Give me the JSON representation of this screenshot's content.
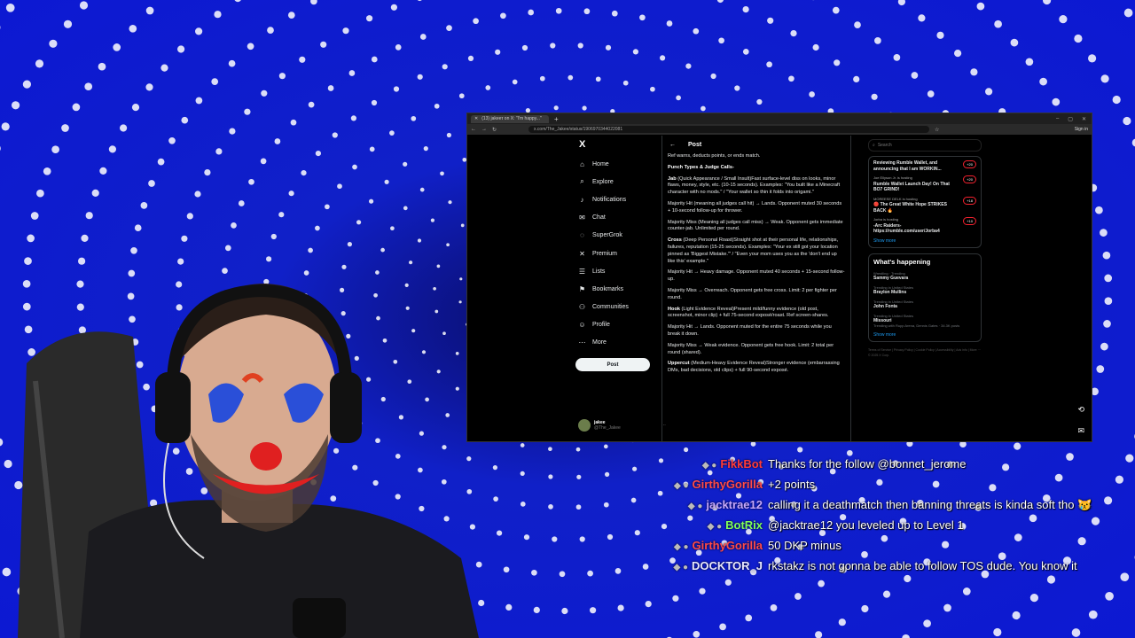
{
  "browser": {
    "tab_title": "(13) jakeeτ on X: \"I'm happy...\"",
    "url": "x.com/The_Jakee/status/1906970344022081",
    "sign_in": "Sign in"
  },
  "x": {
    "logo": "X",
    "nav": [
      {
        "label": "Home",
        "icon": "home-icon",
        "glyph": "⌂"
      },
      {
        "label": "Explore",
        "icon": "search-icon",
        "glyph": "⌕"
      },
      {
        "label": "Notifications",
        "icon": "bell-icon",
        "glyph": "♪"
      },
      {
        "label": "Chat",
        "icon": "mail-icon",
        "glyph": "✉"
      },
      {
        "label": "SuperGrok",
        "icon": "grok-icon",
        "glyph": "◌"
      },
      {
        "label": "Premium",
        "icon": "x-icon",
        "glyph": "✕"
      },
      {
        "label": "Lists",
        "icon": "list-icon",
        "glyph": "☰"
      },
      {
        "label": "Bookmarks",
        "icon": "bookmark-icon",
        "glyph": "⚑"
      },
      {
        "label": "Communities",
        "icon": "people-icon",
        "glyph": "⚇"
      },
      {
        "label": "Profile",
        "icon": "profile-icon",
        "glyph": "☺"
      },
      {
        "label": "More",
        "icon": "more-icon",
        "glyph": "⋯"
      }
    ],
    "post_button": "Post",
    "account": {
      "name": "jakee",
      "handle": "@The_Jakee"
    },
    "post_header": "Post",
    "thread": [
      {
        "bold": "",
        "text": "Ref warns, deducts points, or ends match."
      },
      {
        "bold": "Punch Types & Judge Calls-",
        "text": ""
      },
      {
        "bold": "Jab",
        "text": " (Quick Appearance / Small Insult)Fast surface-level diss on looks, minor flaws, money, style, etc. (10-15 seconds). Examples: \"You built like a Minecraft character with no mods.\" / \"Your wallet so thin it folds into origami.\""
      },
      {
        "bold": "",
        "text": "Majority Hit (meaning all judges call hit) → Lands. Opponent muted 30 seconds + 10-second follow-up for thrower."
      },
      {
        "bold": "",
        "text": "Majority Miss (Meaning all judges call miss) → Weak. Opponent gets immediate counter-jab. Unlimited per round."
      },
      {
        "bold": "Cross",
        "text": " (Deep Personal Roast)Straight shot at their personal life, relationships, failures, reputation (15-25 seconds). Examples: \"Your ex still got your location pinned as 'Biggest Mistake.'\" / \"Even your mom uses you as the 'don't end up like this' example.\""
      },
      {
        "bold": "",
        "text": "Majority Hit → Heavy damage. Opponent muted 40 seconds + 15-second follow-up."
      },
      {
        "bold": "",
        "text": "Majority Miss → Overreach. Opponent gets free cross. Limit: 2 per fighter per round."
      },
      {
        "bold": "Hook",
        "text": " (Light Evidence Reveal)Present mild/funny evidence (old post, screenshot, minor clip) + full 75-second exposé/roast. Ref screen-shares."
      },
      {
        "bold": "",
        "text": "Majority Hit → Lands. Opponent muted for the entire 75 seconds while you break it down."
      },
      {
        "bold": "",
        "text": "Majority Miss → Weak evidence. Opponent gets free hook. Limit: 2 total per round (shared)."
      },
      {
        "bold": "Uppercut",
        "text": " (Medium-Heavy Evidence Reveal)Stronger evidence (embarrassing DMs, bad decisions, old clips) + full 90-second exposé."
      }
    ],
    "search_placeholder": "Search",
    "live": [
      {
        "title": "Reviewing Rumble Wallet, and announcing that I am WORKIN...",
        "host": "",
        "count": "+20"
      },
      {
        "title": "Rumble Wallet Launch Day! On That BO7 GRIND!",
        "host": "Joe Ellyson Jr. is hosting",
        "count": "+20"
      },
      {
        "title": "🔴 The Great White Hope STRIKES BACK 🔥",
        "host": "MOREESE DELK is hosting",
        "count": "+18"
      },
      {
        "title": "-Arc Raiders- https://rumble.com/user/Jorba4",
        "host": "Jorba is hosting",
        "count": "+10"
      }
    ],
    "live_show_more": "Show more",
    "whats_happening": "What's happening",
    "trends": [
      {
        "ctx": "Wrestling · Trending",
        "name": "Sammy Guevara",
        "sub": ""
      },
      {
        "ctx": "Trending in United States",
        "name": "Braylon Mullins",
        "sub": ""
      },
      {
        "ctx": "Trending in United States",
        "name": "John Fonta",
        "sub": ""
      },
      {
        "ctx": "Trending in United States",
        "name": "Missouri",
        "sub": "Trending with Rupp Arena, Dennis Gates · 34.3K posts"
      }
    ],
    "trends_show_more": "Show more",
    "footer": "Terms of Service | Privacy Policy | Cookie Policy | Accessibility | Ads info | More ··· © 2025 X Corp."
  },
  "chat": [
    {
      "user": "FikkBot",
      "color": "#ff3b3b",
      "text": "Thanks for the follow @bonnet_jerome"
    },
    {
      "user": "GirthyGorilla",
      "color": "#ff4a4a",
      "text": "+2 points"
    },
    {
      "user": "jacktrae12",
      "color": "#c6a8ff",
      "text": "calling it a deathmatch then banning threats is kinda soft tho 😿"
    },
    {
      "user": "BotRix",
      "color": "#7fff5a",
      "text": "@jacktrae12 you leveled up to Level 1"
    },
    {
      "user": "GirthyGorilla",
      "color": "#ff4a4a",
      "text": "50 DKP minus"
    },
    {
      "user": "DOCKTOR_J",
      "color": "#e8e8ff",
      "text": "rkstakz is not gonna be able to follow TOS dude. You know it"
    }
  ]
}
